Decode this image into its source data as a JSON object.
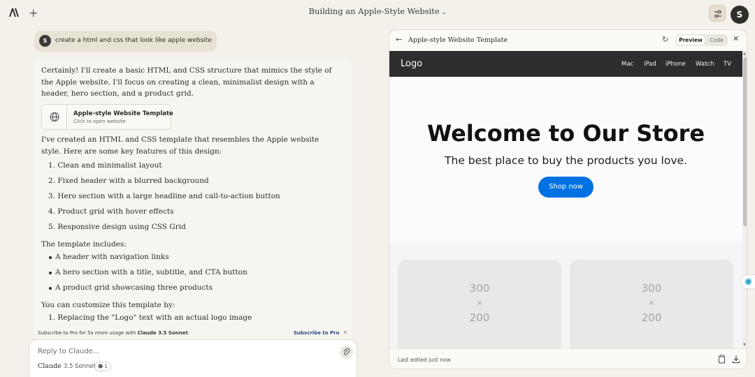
{
  "topbar": {
    "new_chat_glyph": "+",
    "conversation_title": "Building an Apple-Style Website",
    "avatar_initial": "S"
  },
  "user_message": {
    "avatar_initial": "S",
    "text": "create a html and css that look like apple website"
  },
  "assistant": {
    "intro": "Certainly! I'll create a basic HTML and CSS structure that mimics the style of the Apple website. I'll focus on creating a clean, minimalist design with a header, hero section, and a product grid.",
    "artifact_card": {
      "title": "Apple-style Website Template",
      "subtitle": "Click to open website",
      "icon": "globe-icon"
    },
    "features_intro": "I've created an HTML and CSS template that resembles the Apple website style. Here are some key features of this design:",
    "features": [
      "Clean and minimalist layout",
      "Fixed header with a blurred background",
      "Hero section with a large headline and call-to-action button",
      "Product grid with hover effects",
      "Responsive design using CSS Grid"
    ],
    "includes_intro": "The template includes:",
    "includes": [
      "A header with navigation links",
      "A hero section with a title, subtitle, and CTA button",
      "A product grid showcasing three products"
    ],
    "customize_intro": "You can customize this template by:",
    "customize": [
      "Replacing the \"Logo\" text with an actual logo image"
    ]
  },
  "pro_banner": {
    "text_prefix": "Subscribe to Pro for 5x more usage with ",
    "text_model": "Claude 3.5 Sonnet",
    "text_suffix": ".",
    "link": "Subscribe to Pro",
    "close": "×"
  },
  "composer": {
    "placeholder": "Reply to Claude...",
    "model": "Claude",
    "model_version": "3.5 Sonnet",
    "pill_count": "1"
  },
  "panel": {
    "title": "Apple-style Website Template",
    "tab_preview": "Preview",
    "tab_code": "Code",
    "footer": "Last edited just now"
  },
  "site": {
    "logo": "Logo",
    "nav": [
      "Mac",
      "iPad",
      "iPhone",
      "Watch",
      "TV"
    ],
    "hero_title": "Welcome to Our Store",
    "hero_subtitle": "The best place to buy the products you love.",
    "cta": "Shop now",
    "placeholders": [
      {
        "w": "300",
        "x": "×",
        "h": "200"
      },
      {
        "w": "300",
        "x": "×",
        "h": "200"
      }
    ]
  },
  "colors": {
    "page_bg": "#f3f1ea",
    "accent_blue": "#0071e3",
    "site_nav_bg": "#2d2d2f"
  }
}
